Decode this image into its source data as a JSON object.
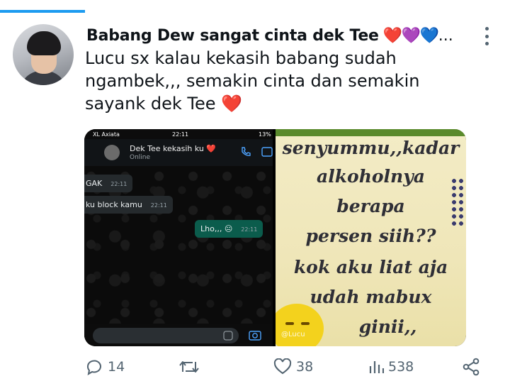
{
  "tweet": {
    "display_name": "Babang Dew sangat cinta dek Tee",
    "name_suffix": "...",
    "text_lines": [
      "Lucu sx kalau kekasih babang sudah",
      "ngambek,,, semakin cinta dan semakin",
      "sayank dek Tee"
    ],
    "name_hearts": [
      "❤️",
      "💜",
      "💙"
    ],
    "text_heart": "❤️"
  },
  "media": {
    "chat": {
      "carrier": "XL Axiata",
      "time": "22:11",
      "battery": "13%",
      "contact_name": "Dek Tee kekasih ku ❤️",
      "contact_status": "Online",
      "messages": [
        {
          "text": "GAK",
          "time": "22:11",
          "direction": "in"
        },
        {
          "text": "ku block kamu",
          "time": "22:11",
          "direction": "in"
        },
        {
          "text": "Lho,,, 😐",
          "time": "22:11",
          "direction": "out"
        }
      ]
    },
    "quote": {
      "lines": [
        "senyummu,,kadar",
        "alkoholnya",
        "berapa",
        "persen siih??",
        "kok aku liat aja",
        "udah mabux",
        "ginii,,"
      ],
      "watermark": "@Lucu"
    }
  },
  "actions": {
    "replies": "14",
    "retweets": "",
    "likes": "38",
    "views": "538"
  },
  "colors": {
    "accent": "#1d9bf0",
    "icon_gray": "#536471",
    "heart_red": "#e0202a"
  }
}
